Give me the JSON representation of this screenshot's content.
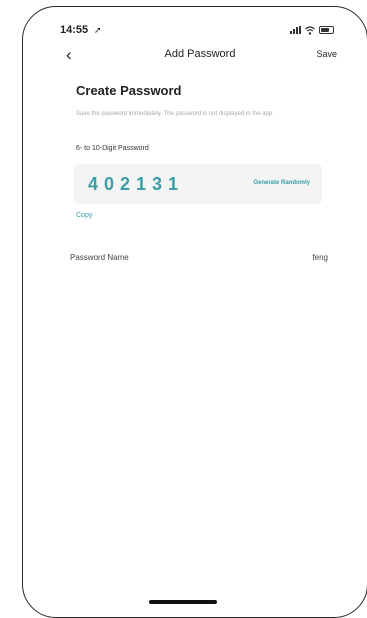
{
  "status_bar": {
    "time": "14:55",
    "location_glyph": "➚",
    "icons": [
      "signal-icon",
      "wifi-icon",
      "battery-icon"
    ]
  },
  "nav": {
    "back_glyph": "‹",
    "title": "Add Password",
    "save_label": "Save"
  },
  "heading": "Create Password",
  "notice": "Save the password immediately. The password is not displayed in the app.",
  "password": {
    "length_label": "6- to 10-Digit Password",
    "digits": "402131",
    "generate_label": "Generate Randomly",
    "copy_label": "Copy"
  },
  "name_field": {
    "label": "Password Name",
    "value": "feng"
  },
  "colors": {
    "accent": "#3a9ea6",
    "text": "#222222",
    "muted": "#a9a9a9",
    "box": "#f4f4f4"
  }
}
